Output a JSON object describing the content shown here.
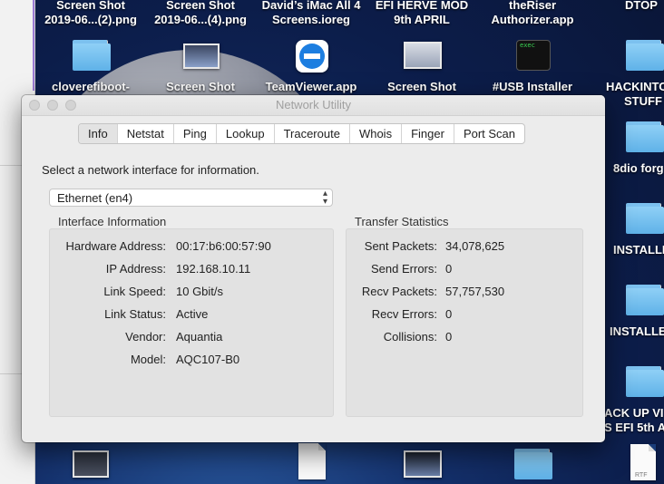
{
  "desktop": {
    "top_labels": [
      {
        "l1": "Screen Shot",
        "l2": "2019-06...(2).png"
      },
      {
        "l1": "Screen Shot",
        "l2": "2019-06...(4).png"
      },
      {
        "l1": "David’s iMac All 4",
        "l2": "Screens.ioreg"
      },
      {
        "l1": "EFI HERVE MOD",
        "l2": "9th APRIL"
      },
      {
        "l1": "theRiser",
        "l2": "Authorizer.app"
      },
      {
        "l1": "DTOP",
        "l2": ""
      }
    ],
    "row2_labels": [
      "cloverefiboot-",
      "Screen Shot",
      "TeamViewer.app",
      "Screen Shot",
      "#USB Installer"
    ],
    "right_labels": [
      {
        "l1": "HACKINTO",
        "l2": "STUFF"
      },
      {
        "l1": "8dio forg",
        "l2": ""
      },
      {
        "l1": "INSTALLE",
        "l2": ""
      },
      {
        "l1": "INSTALLE",
        "l2": ""
      },
      {
        "l1": "ACK UP VI",
        "l2": "S EFI 5th A"
      }
    ],
    "exec_text": "exec",
    "rtf_text": "RTF"
  },
  "window": {
    "title": "Network Utility",
    "tabs": [
      "Info",
      "Netstat",
      "Ping",
      "Lookup",
      "Traceroute",
      "Whois",
      "Finger",
      "Port Scan"
    ],
    "active_tab": "Info",
    "prompt": "Select a network interface for information.",
    "interface_select": "Ethernet (en4)",
    "interface_info": {
      "title": "Interface Information",
      "rows": [
        {
          "label": "Hardware Address:",
          "value": "00:17:b6:00:57:90"
        },
        {
          "label": "IP Address:",
          "value": "192.168.10.11"
        },
        {
          "label": "Link Speed:",
          "value": "10 Gbit/s"
        },
        {
          "label": "Link Status:",
          "value": "Active"
        },
        {
          "label": "Vendor:",
          "value": "Aquantia"
        },
        {
          "label": "Model:",
          "value": "AQC107-B0"
        }
      ]
    },
    "transfer_stats": {
      "title": "Transfer Statistics",
      "rows": [
        {
          "label": "Sent Packets:",
          "value": "34,078,625"
        },
        {
          "label": "Send Errors:",
          "value": "0"
        },
        {
          "label": "Recv Packets:",
          "value": "57,757,530"
        },
        {
          "label": "Recv Errors:",
          "value": "0"
        },
        {
          "label": "Collisions:",
          "value": "0"
        }
      ]
    }
  },
  "colors": {
    "folder": "#5fb2e8",
    "teamviewer": "#1d7ee0"
  }
}
